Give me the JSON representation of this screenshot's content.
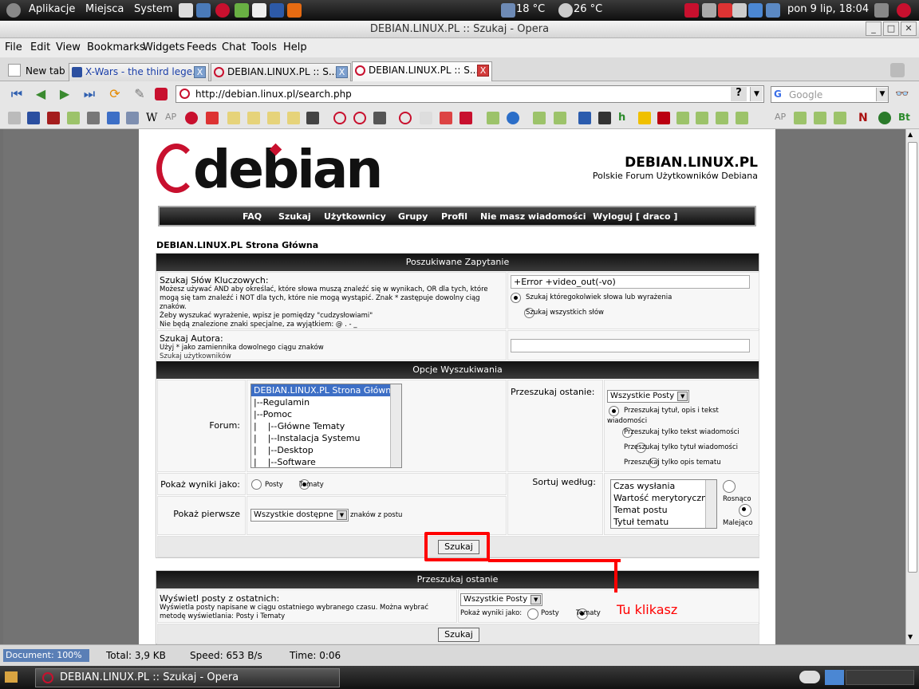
{
  "panel": {
    "apps": "Aplikacje",
    "places": "Miejsca",
    "system": "System",
    "weather1": "18 °C",
    "weather2": "26 °C",
    "clock": "pon  9 lip, 18:04"
  },
  "window": {
    "title": "DEBIAN.LINUX.PL :: Szukaj - Opera"
  },
  "menu": [
    "File",
    "Edit",
    "View",
    "Bookmarks",
    "Widgets",
    "Feeds",
    "Chat",
    "Tools",
    "Help"
  ],
  "tabs": {
    "new_tab": "New tab",
    "t1": "X-Wars - the third lege...",
    "t2": "DEBIAN.LINUX.PL :: S...",
    "t3": "DEBIAN.LINUX.PL :: S...",
    "close": "X"
  },
  "address": {
    "url": "http://debian.linux.pl/search.php",
    "help": "?",
    "search_placeholder": "Google"
  },
  "site": {
    "logo": "debian",
    "name": "DEBIAN.LINUX.PL",
    "tagline": "Polskie Forum Użytkowników Debiana",
    "nav": [
      "FAQ",
      "Szukaj",
      "Użytkownicy",
      "Grupy",
      "Profil",
      "Nie masz wiadomości",
      "Wyloguj [ draco ]"
    ],
    "breadcrumb": "DEBIAN.LINUX.PL Strona Główna"
  },
  "form": {
    "hdr1": "Poszukiwane Zapytanie",
    "kw_title": "Szukaj Słów Kluczowych:",
    "kw_desc1": "Możesz używać AND aby określać, które słowa muszą znaleźć się w wynikach, OR dla tych, które",
    "kw_desc2": "mogą się tam znaleźć i NOT dla tych, które nie mogą wystąpić. Znak * zastępuje dowolny ciąg",
    "kw_desc3": "znaków.",
    "kw_desc4": "Żeby wyszukać wyrażenie, wpisz je pomiędzy \"cudzysłowiami\"",
    "kw_desc5": "Nie będą znalezione znaki specjalne, za wyjątkiem: @ . - _",
    "kw_value": "+Error +video_out(-vo)",
    "kw_any": "Szukaj któregokolwiek słowa lub wyrażenia",
    "kw_all": "Szukaj wszystkich słów",
    "author_title": "Szukaj Autora:",
    "author_desc1": "Użyj * jako zamiennika dowolnego ciągu znaków",
    "author_desc2": "Szukaj użytkowników",
    "hdr2": "Opcje Wyszukiwania",
    "forum_label": "Forum:",
    "forums": [
      "DEBIAN.LINUX.PL Strona Główna",
      "|--Regulamin",
      "|--Pomoc",
      "|    |--Główne Tematy",
      "|    |--Instalacja Systemu",
      "|    |--Desktop",
      "|    |--Software"
    ],
    "recent_label": "Przeszukaj ostanie:",
    "recent_value": "Wszystkie Posty",
    "scope1a": "Przeszukaj tytuł, opis i tekst",
    "scope1b": "wiadomości",
    "scope2": "Przeszukaj tylko tekst wiadomości",
    "scope3": "Przeszukaj tylko tytuł wiadomości",
    "scope4": "Przeszukaj tylko opis tematu",
    "show_label": "Pokaż wyniki jako:",
    "posts": "Posty",
    "topics": "Tematy",
    "sort_label": "Sortuj według:",
    "sort_opts": [
      "Czas wysłania",
      "Wartość merytoryczna",
      "Temat postu",
      "Tytuł tematu"
    ],
    "asc": "Rosnąco",
    "desc": "Malejąco",
    "first_label": "Pokaż pierwsze",
    "first_value": "Wszystkie dostępne",
    "first_suffix": "znaków z postu",
    "submit": "Szukaj",
    "hdr3": "Przeszukaj ostanie",
    "recent2_title": "Wyświetl posty z ostatnich:",
    "recent2_desc1": "Wyświetla posty napisane w ciągu ostatniego wybranego czasu. Można wybrać",
    "recent2_desc2": "metodę wyświetlania: Posty i Tematy",
    "recent2_value": "Wszystkie Posty",
    "recent2_show": "Pokaż wyniki jako:"
  },
  "annotation": {
    "text": "Tu klikasz",
    "color": "#ff0000"
  },
  "status": {
    "doc": "Document:  100%",
    "total": "Total:  3,9 KB",
    "speed": "Speed:  653 B/s",
    "time": "Time:  0:06"
  },
  "taskbar": {
    "item": "DEBIAN.LINUX.PL :: Szukaj - Opera"
  }
}
